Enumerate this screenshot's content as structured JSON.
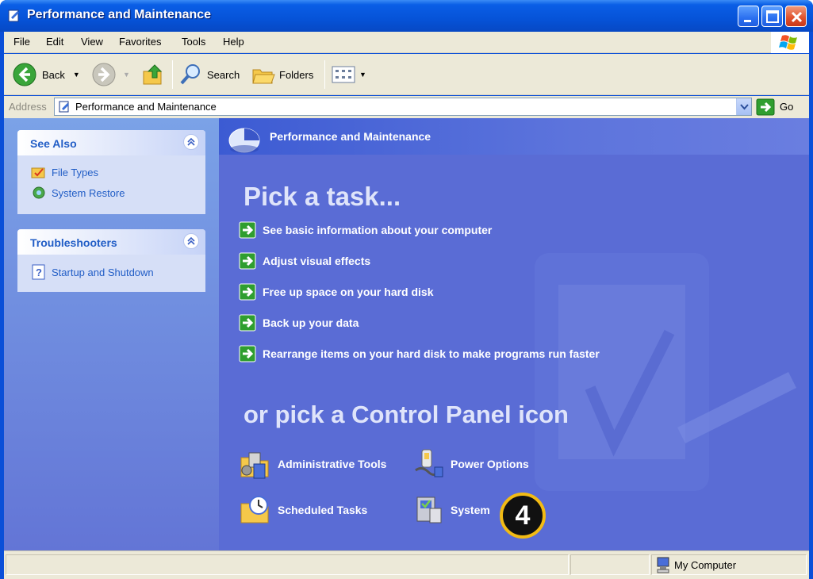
{
  "window": {
    "title": "Performance and Maintenance"
  },
  "menu": [
    "File",
    "Edit",
    "View",
    "Favorites",
    "Tools",
    "Help"
  ],
  "toolbar": {
    "back_label": "Back",
    "search_label": "Search",
    "folders_label": "Folders"
  },
  "address": {
    "label": "Address",
    "value": "Performance and Maintenance",
    "go_label": "Go"
  },
  "sidebar": {
    "see_also": {
      "title": "See Also",
      "links": [
        "File Types",
        "System Restore"
      ]
    },
    "troubleshooters": {
      "title": "Troubleshooters",
      "links": [
        "Startup and Shutdown"
      ]
    }
  },
  "main": {
    "header_title": "Performance and Maintenance",
    "pick_task": "Pick a task...",
    "tasks": [
      "See basic information about your computer",
      "Adjust visual effects",
      "Free up space on your hard disk",
      "Back up your data",
      "Rearrange items on your hard disk to make programs run faster"
    ],
    "pick_icon": "or pick a Control Panel icon",
    "icons": [
      "Administrative Tools",
      "Power Options",
      "Scheduled Tasks",
      "System"
    ],
    "step_badge": "4"
  },
  "status": {
    "zone": "My Computer"
  },
  "colors": {
    "titlebar": "#0653d8",
    "main_bg": "#5a6cd5",
    "sidebar_link": "#215dc6",
    "badge_ring": "#f2bb14"
  }
}
